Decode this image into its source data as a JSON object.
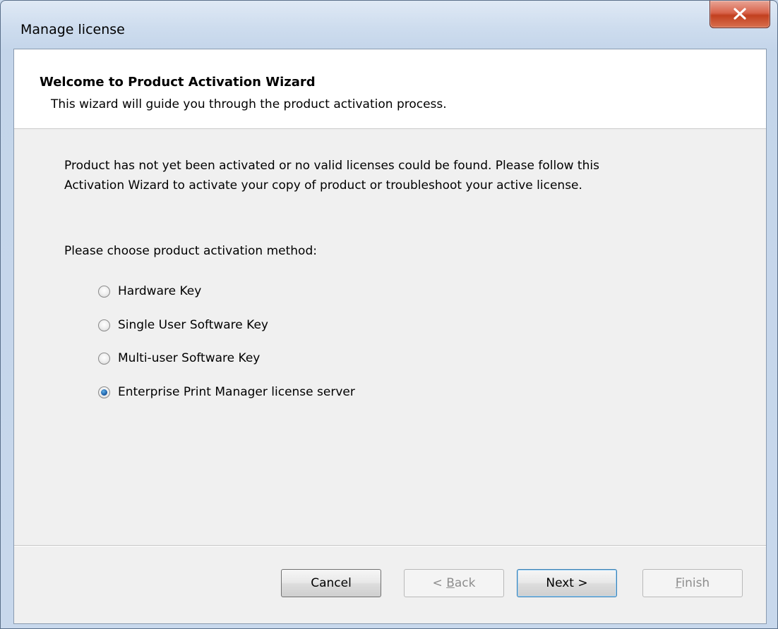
{
  "window": {
    "title": "Manage license"
  },
  "header": {
    "title": "Welcome to Product Activation Wizard",
    "subtitle": "This wizard will guide you through the product activation process."
  },
  "body": {
    "intro_line1": "Product has not yet been activated or no valid licenses could be found. Please follow this",
    "intro_line2": "Activation Wizard to activate your copy of product or troubleshoot your active license.",
    "choose_label": "Please choose product activation method:"
  },
  "activation_methods": [
    {
      "label": "Hardware Key",
      "selected": false
    },
    {
      "label": "Single User Software Key",
      "selected": false
    },
    {
      "label": "Multi-user Software Key",
      "selected": false
    },
    {
      "label": "Enterprise Print Manager license server",
      "selected": true
    }
  ],
  "buttons": {
    "cancel": "Cancel",
    "back_prefix": "< ",
    "back_mnemonic": "B",
    "back_rest": "ack",
    "next": "Next >",
    "finish_mnemonic": "F",
    "finish_rest": "inish"
  },
  "icons": {
    "close": "close-icon"
  },
  "colors": {
    "close_button": "#c7452b",
    "selected_radio": "#1d5fa8"
  }
}
